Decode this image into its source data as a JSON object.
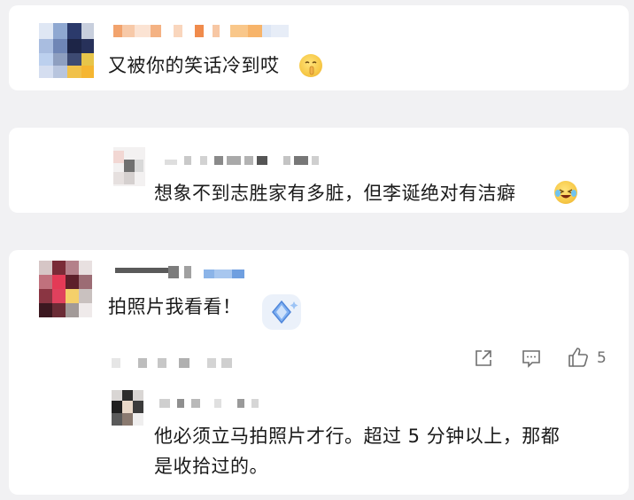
{
  "comments": [
    {
      "text": "又被你的笑话冷到哎",
      "emoji_icon": "shushing-face-emoji-icon"
    },
    {
      "text": "想象不到志胜家有多脏，但李诞绝对有洁癖",
      "emoji_icon": "laughing-crying-emoji-icon"
    },
    {
      "text": "拍照片我看看！",
      "sticker_icon": "blue-diamond-sticker-icon",
      "actions": {
        "share_icon": "share-icon",
        "comment_icon": "comment-icon",
        "like_icon": "thumbs-up-icon",
        "like_count": "5"
      },
      "reply": {
        "text_line1": "他必须立马拍照片才行。超过 5 分钟以上，那都",
        "text_line2": "是收拾过的。"
      }
    }
  ],
  "colors": {
    "background": "#f1f1f3",
    "card": "#ffffff",
    "text": "#1a1a1a",
    "icon": "#6f6f6f"
  }
}
